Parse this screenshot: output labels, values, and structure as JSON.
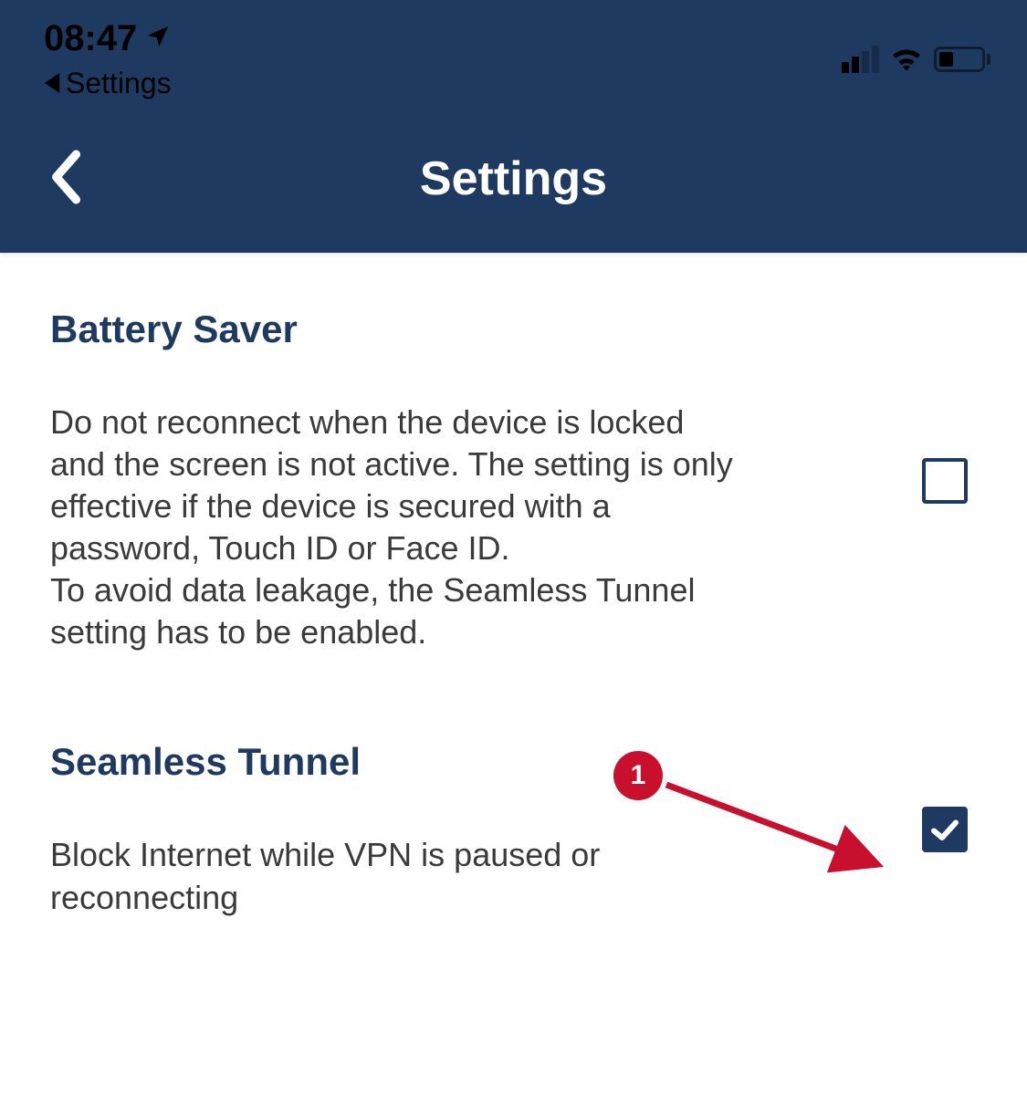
{
  "statusBar": {
    "time": "08:47",
    "breadcrumb": "Settings"
  },
  "nav": {
    "title": "Settings"
  },
  "settings": {
    "batterySaver": {
      "title": "Battery Saver",
      "description": "Do not reconnect when the device is locked and the screen is not active. The setting is only effective if the device is secured with a password, Touch ID or Face ID.\nTo avoid data leakage, the Seamless Tunnel setting has to be enabled.",
      "checked": false
    },
    "seamlessTunnel": {
      "title": "Seamless Tunnel",
      "description": "Block Internet while VPN is paused or reconnecting",
      "checked": true
    }
  },
  "annotation": {
    "label": "1"
  }
}
